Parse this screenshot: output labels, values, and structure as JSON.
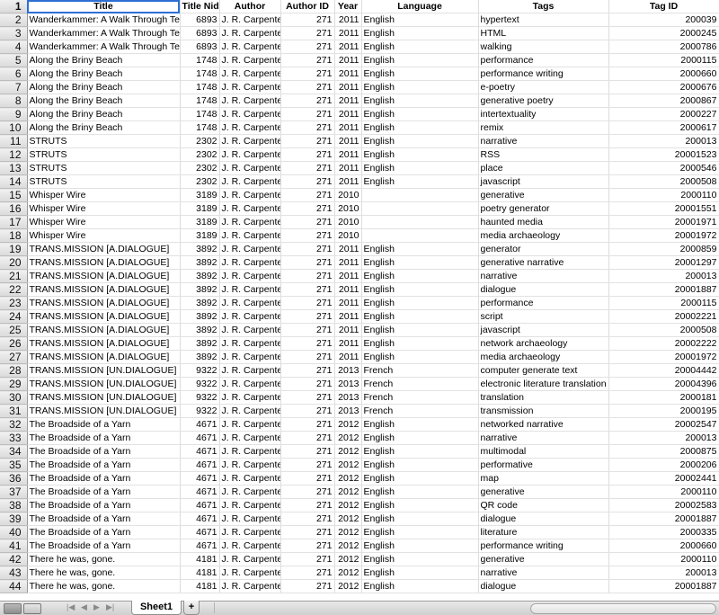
{
  "headers": {
    "row": "1",
    "title": "Title",
    "title_nid": "Title Nid",
    "author": "Author",
    "author_id": "Author ID",
    "year": "Year",
    "language": "Language",
    "tags": "Tags",
    "tag_id": "Tag ID"
  },
  "rows": [
    {
      "n": "2",
      "title": "Wanderkammer: A Walk Through Texts",
      "nid": "6893",
      "author": "J. R. Carpenter",
      "aid": "271",
      "year": "2011",
      "lang": "English",
      "tag": "hypertext",
      "tid": "200039"
    },
    {
      "n": "3",
      "title": "Wanderkammer: A Walk Through Texts",
      "nid": "6893",
      "author": "J. R. Carpenter",
      "aid": "271",
      "year": "2011",
      "lang": "English",
      "tag": "HTML",
      "tid": "2000245"
    },
    {
      "n": "4",
      "title": "Wanderkammer: A Walk Through Texts",
      "nid": "6893",
      "author": "J. R. Carpenter",
      "aid": "271",
      "year": "2011",
      "lang": "English",
      "tag": "walking",
      "tid": "2000786"
    },
    {
      "n": "5",
      "title": "Along the Briny Beach",
      "nid": "1748",
      "author": "J. R. Carpenter",
      "aid": "271",
      "year": "2011",
      "lang": "English",
      "tag": "performance",
      "tid": "2000115"
    },
    {
      "n": "6",
      "title": "Along the Briny Beach",
      "nid": "1748",
      "author": "J. R. Carpenter",
      "aid": "271",
      "year": "2011",
      "lang": "English",
      "tag": "performance writing",
      "tid": "2000660"
    },
    {
      "n": "7",
      "title": "Along the Briny Beach",
      "nid": "1748",
      "author": "J. R. Carpenter",
      "aid": "271",
      "year": "2011",
      "lang": "English",
      "tag": "e-poetry",
      "tid": "2000676"
    },
    {
      "n": "8",
      "title": "Along the Briny Beach",
      "nid": "1748",
      "author": "J. R. Carpenter",
      "aid": "271",
      "year": "2011",
      "lang": "English",
      "tag": "generative poetry",
      "tid": "2000867"
    },
    {
      "n": "9",
      "title": "Along the Briny Beach",
      "nid": "1748",
      "author": "J. R. Carpenter",
      "aid": "271",
      "year": "2011",
      "lang": "English",
      "tag": "intertextuality",
      "tid": "2000227"
    },
    {
      "n": "10",
      "title": "Along the Briny Beach",
      "nid": "1748",
      "author": "J. R. Carpenter",
      "aid": "271",
      "year": "2011",
      "lang": "English",
      "tag": "remix",
      "tid": "2000617"
    },
    {
      "n": "11",
      "title": "STRUTS",
      "nid": "2302",
      "author": "J. R. Carpenter",
      "aid": "271",
      "year": "2011",
      "lang": "English",
      "tag": "narrative",
      "tid": "200013"
    },
    {
      "n": "12",
      "title": "STRUTS",
      "nid": "2302",
      "author": "J. R. Carpenter",
      "aid": "271",
      "year": "2011",
      "lang": "English",
      "tag": "RSS",
      "tid": "20001523"
    },
    {
      "n": "13",
      "title": "STRUTS",
      "nid": "2302",
      "author": "J. R. Carpenter",
      "aid": "271",
      "year": "2011",
      "lang": "English",
      "tag": "place",
      "tid": "2000546"
    },
    {
      "n": "14",
      "title": "STRUTS",
      "nid": "2302",
      "author": "J. R. Carpenter",
      "aid": "271",
      "year": "2011",
      "lang": "English",
      "tag": "javascript",
      "tid": "2000508"
    },
    {
      "n": "15",
      "title": "Whisper Wire",
      "nid": "3189",
      "author": "J. R. Carpenter",
      "aid": "271",
      "year": "2010",
      "lang": "",
      "tag": "generative",
      "tid": "2000110"
    },
    {
      "n": "16",
      "title": "Whisper Wire",
      "nid": "3189",
      "author": "J. R. Carpenter",
      "aid": "271",
      "year": "2010",
      "lang": "",
      "tag": "poetry generator",
      "tid": "20001551"
    },
    {
      "n": "17",
      "title": "Whisper Wire",
      "nid": "3189",
      "author": "J. R. Carpenter",
      "aid": "271",
      "year": "2010",
      "lang": "",
      "tag": "haunted media",
      "tid": "20001971"
    },
    {
      "n": "18",
      "title": "Whisper Wire",
      "nid": "3189",
      "author": "J. R. Carpenter",
      "aid": "271",
      "year": "2010",
      "lang": "",
      "tag": "media archaeology",
      "tid": "20001972"
    },
    {
      "n": "19",
      "title": "TRANS.MISSION [A.DIALOGUE]",
      "nid": "3892",
      "author": "J. R. Carpenter",
      "aid": "271",
      "year": "2011",
      "lang": "English",
      "tag": "generator",
      "tid": "2000859"
    },
    {
      "n": "20",
      "title": "TRANS.MISSION [A.DIALOGUE]",
      "nid": "3892",
      "author": "J. R. Carpenter",
      "aid": "271",
      "year": "2011",
      "lang": "English",
      "tag": "generative narrative",
      "tid": "20001297"
    },
    {
      "n": "21",
      "title": "TRANS.MISSION [A.DIALOGUE]",
      "nid": "3892",
      "author": "J. R. Carpenter",
      "aid": "271",
      "year": "2011",
      "lang": "English",
      "tag": "narrative",
      "tid": "200013"
    },
    {
      "n": "22",
      "title": "TRANS.MISSION [A.DIALOGUE]",
      "nid": "3892",
      "author": "J. R. Carpenter",
      "aid": "271",
      "year": "2011",
      "lang": "English",
      "tag": "dialogue",
      "tid": "20001887"
    },
    {
      "n": "23",
      "title": "TRANS.MISSION [A.DIALOGUE]",
      "nid": "3892",
      "author": "J. R. Carpenter",
      "aid": "271",
      "year": "2011",
      "lang": "English",
      "tag": "performance",
      "tid": "2000115"
    },
    {
      "n": "24",
      "title": "TRANS.MISSION [A.DIALOGUE]",
      "nid": "3892",
      "author": "J. R. Carpenter",
      "aid": "271",
      "year": "2011",
      "lang": "English",
      "tag": "script",
      "tid": "20002221"
    },
    {
      "n": "25",
      "title": "TRANS.MISSION [A.DIALOGUE]",
      "nid": "3892",
      "author": "J. R. Carpenter",
      "aid": "271",
      "year": "2011",
      "lang": "English",
      "tag": "javascript",
      "tid": "2000508"
    },
    {
      "n": "26",
      "title": "TRANS.MISSION [A.DIALOGUE]",
      "nid": "3892",
      "author": "J. R. Carpenter",
      "aid": "271",
      "year": "2011",
      "lang": "English",
      "tag": "network archaeology",
      "tid": "20002222"
    },
    {
      "n": "27",
      "title": "TRANS.MISSION [A.DIALOGUE]",
      "nid": "3892",
      "author": "J. R. Carpenter",
      "aid": "271",
      "year": "2011",
      "lang": "English",
      "tag": "media archaeology",
      "tid": "20001972"
    },
    {
      "n": "28",
      "title": "TRANS.MISSION [UN.DIALOGUE]",
      "nid": "9322",
      "author": "J. R. Carpenter",
      "aid": "271",
      "year": "2013",
      "lang": "French",
      "tag": "computer generate text",
      "tid": "20004442"
    },
    {
      "n": "29",
      "title": "TRANS.MISSION [UN.DIALOGUE]",
      "nid": "9322",
      "author": "J. R. Carpenter",
      "aid": "271",
      "year": "2013",
      "lang": "French",
      "tag": "electronic literature translation",
      "tid": "20004396"
    },
    {
      "n": "30",
      "title": "TRANS.MISSION [UN.DIALOGUE]",
      "nid": "9322",
      "author": "J. R. Carpenter",
      "aid": "271",
      "year": "2013",
      "lang": "French",
      "tag": "translation",
      "tid": "2000181"
    },
    {
      "n": "31",
      "title": "TRANS.MISSION [UN.DIALOGUE]",
      "nid": "9322",
      "author": "J. R. Carpenter",
      "aid": "271",
      "year": "2013",
      "lang": "French",
      "tag": "transmission",
      "tid": "2000195"
    },
    {
      "n": "32",
      "title": "The Broadside of a Yarn",
      "nid": "4671",
      "author": "J. R. Carpenter",
      "aid": "271",
      "year": "2012",
      "lang": "English",
      "tag": "networked narrative",
      "tid": "20002547"
    },
    {
      "n": "33",
      "title": "The Broadside of a Yarn",
      "nid": "4671",
      "author": "J. R. Carpenter",
      "aid": "271",
      "year": "2012",
      "lang": "English",
      "tag": "narrative",
      "tid": "200013"
    },
    {
      "n": "34",
      "title": "The Broadside of a Yarn",
      "nid": "4671",
      "author": "J. R. Carpenter",
      "aid": "271",
      "year": "2012",
      "lang": "English",
      "tag": "multimodal",
      "tid": "2000875"
    },
    {
      "n": "35",
      "title": "The Broadside of a Yarn",
      "nid": "4671",
      "author": "J. R. Carpenter",
      "aid": "271",
      "year": "2012",
      "lang": "English",
      "tag": "performative",
      "tid": "2000206"
    },
    {
      "n": "36",
      "title": "The Broadside of a Yarn",
      "nid": "4671",
      "author": "J. R. Carpenter",
      "aid": "271",
      "year": "2012",
      "lang": "English",
      "tag": "map",
      "tid": "20002441"
    },
    {
      "n": "37",
      "title": "The Broadside of a Yarn",
      "nid": "4671",
      "author": "J. R. Carpenter",
      "aid": "271",
      "year": "2012",
      "lang": "English",
      "tag": "generative",
      "tid": "2000110"
    },
    {
      "n": "38",
      "title": "The Broadside of a Yarn",
      "nid": "4671",
      "author": "J. R. Carpenter",
      "aid": "271",
      "year": "2012",
      "lang": "English",
      "tag": "QR code",
      "tid": "20002583"
    },
    {
      "n": "39",
      "title": "The Broadside of a Yarn",
      "nid": "4671",
      "author": "J. R. Carpenter",
      "aid": "271",
      "year": "2012",
      "lang": "English",
      "tag": "dialogue",
      "tid": "20001887"
    },
    {
      "n": "40",
      "title": "The Broadside of a Yarn",
      "nid": "4671",
      "author": "J. R. Carpenter",
      "aid": "271",
      "year": "2012",
      "lang": "English",
      "tag": "literature",
      "tid": "2000335"
    },
    {
      "n": "41",
      "title": "The Broadside of a Yarn",
      "nid": "4671",
      "author": "J. R. Carpenter",
      "aid": "271",
      "year": "2012",
      "lang": "English",
      "tag": "performance writing",
      "tid": "2000660"
    },
    {
      "n": "42",
      "title": "There he was, gone.",
      "nid": "4181",
      "author": "J. R. Carpenter",
      "aid": "271",
      "year": "2012",
      "lang": "English",
      "tag": "generative",
      "tid": "2000110"
    },
    {
      "n": "43",
      "title": "There he was, gone.",
      "nid": "4181",
      "author": "J. R. Carpenter",
      "aid": "271",
      "year": "2012",
      "lang": "English",
      "tag": "narrative",
      "tid": "200013"
    },
    {
      "n": "44",
      "title": "There he was, gone.",
      "nid": "4181",
      "author": "J. R. Carpenter",
      "aid": "271",
      "year": "2012",
      "lang": "English",
      "tag": "dialogue",
      "tid": "20001887"
    }
  ],
  "tabs": {
    "sheet1": "Sheet1",
    "add": "+"
  },
  "icons": {
    "normal_view": "normal-view-icon",
    "page_layout_view": "page-layout-view-icon",
    "nav_first": "nav-first-icon",
    "nav_prev": "nav-prev-icon",
    "nav_next": "nav-next-icon",
    "nav_last": "nav-last-icon"
  },
  "colors": {
    "selection": "#2e6fd6",
    "header_bg": "#e5e5e5"
  }
}
